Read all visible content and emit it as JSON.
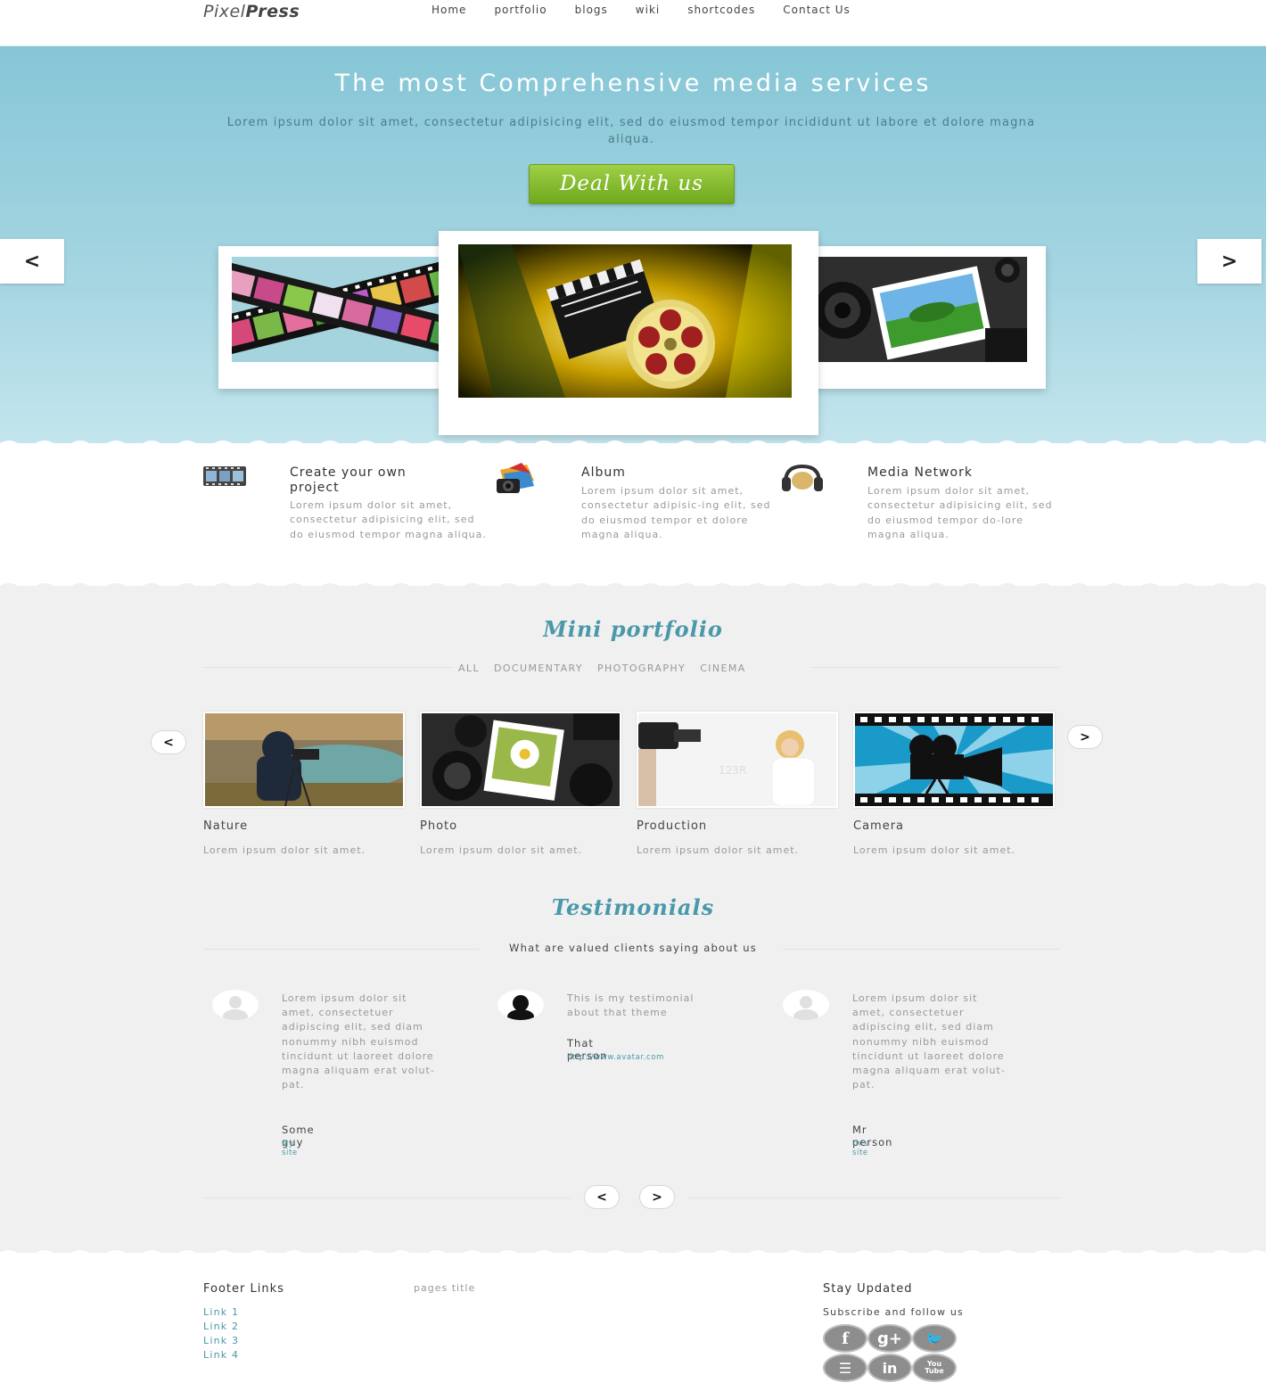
{
  "header": {
    "logo_light": "Pixel",
    "logo_bold": "Press",
    "nav": [
      "Home",
      "portfolio",
      "blogs",
      "wiki",
      "shortcodes",
      "Contact Us"
    ]
  },
  "hero": {
    "title": "The most Comprehensive media services",
    "subtitle": "Lorem ipsum dolor sit amet, consectetur adipisicing elit, sed do eiusmod tempor incididunt ut labore et dolore magna aliqua.",
    "button": "Deal With us",
    "prev": "<",
    "next": ">"
  },
  "features": [
    {
      "title": "Create your own project",
      "text": "Lorem ipsum dolor sit amet, consectetur adipisicing elit, sed do eiusmod tempor magna aliqua.",
      "icon": "film-strip-icon"
    },
    {
      "title": "Album",
      "text": "Lorem ipsum dolor sit amet, consectetur adipisic-ing elit, sed do eiusmod tempor et dolore magna aliqua.",
      "icon": "photo-album-icon"
    },
    {
      "title": "Media Network",
      "text": "Lorem ipsum dolor sit amet, consectetur adipisicing elit, sed do eiusmod tempor do-lore magna aliqua.",
      "icon": "headphones-icon"
    }
  ],
  "portfolio": {
    "title": "Mini portfolio",
    "filters": [
      "ALL",
      "DOCUMENTARY",
      "PHOTOGRAPHY",
      "CINEMA"
    ],
    "prev": "<",
    "next": ">",
    "items": [
      {
        "title": "Nature",
        "desc": "Lorem ipsum dolor sit amet."
      },
      {
        "title": "Photo",
        "desc": "Lorem ipsum dolor sit amet."
      },
      {
        "title": "Production",
        "desc": "Lorem ipsum dolor sit amet."
      },
      {
        "title": "Camera",
        "desc": "Lorem ipsum dolor sit amet."
      }
    ]
  },
  "testimonials": {
    "title": "Testimonials",
    "subtitle": "What are valued clients saying about us",
    "prev": "<",
    "next": ">",
    "items": [
      {
        "quote": "Lorem ipsum dolor sit amet, consectetuer adipiscing elit, sed diam nonummy nibh euismod tincidunt ut laoreet dolore magna aliquam erat volut-pat.",
        "name": "Some guy",
        "site": "My site"
      },
      {
        "quote": "This is my testimonial about that theme",
        "name": "That person",
        "site": "http://www.avatar.com"
      },
      {
        "quote": "Lorem ipsum dolor sit amet, consectetuer adipiscing elit, sed diam nonummy nibh euismod tincidunt ut laoreet dolore magna aliquam erat volut-pat.",
        "name": "Mr person",
        "site": "this site"
      }
    ]
  },
  "footer": {
    "links_title": "Footer Links",
    "pages_title": "pages title",
    "links": [
      "Link 1",
      "Link 2",
      "Link 3",
      "Link 4"
    ],
    "stay_title": "Stay Updated",
    "subscribe": "Subscribe and follow us",
    "social": [
      {
        "icon": "facebook-icon",
        "glyph": "f"
      },
      {
        "icon": "google-plus-icon",
        "glyph": "g+"
      },
      {
        "icon": "twitter-icon",
        "glyph": "🐦"
      },
      {
        "icon": "rss-icon",
        "glyph": "☰"
      },
      {
        "icon": "linkedin-icon",
        "glyph": "in"
      },
      {
        "icon": "youtube-icon",
        "glyph": "You Tube"
      }
    ]
  },
  "colors": {
    "accent": "#4a98aa",
    "hero_top": "#86c6d6",
    "button_green": "#8cc43b"
  }
}
